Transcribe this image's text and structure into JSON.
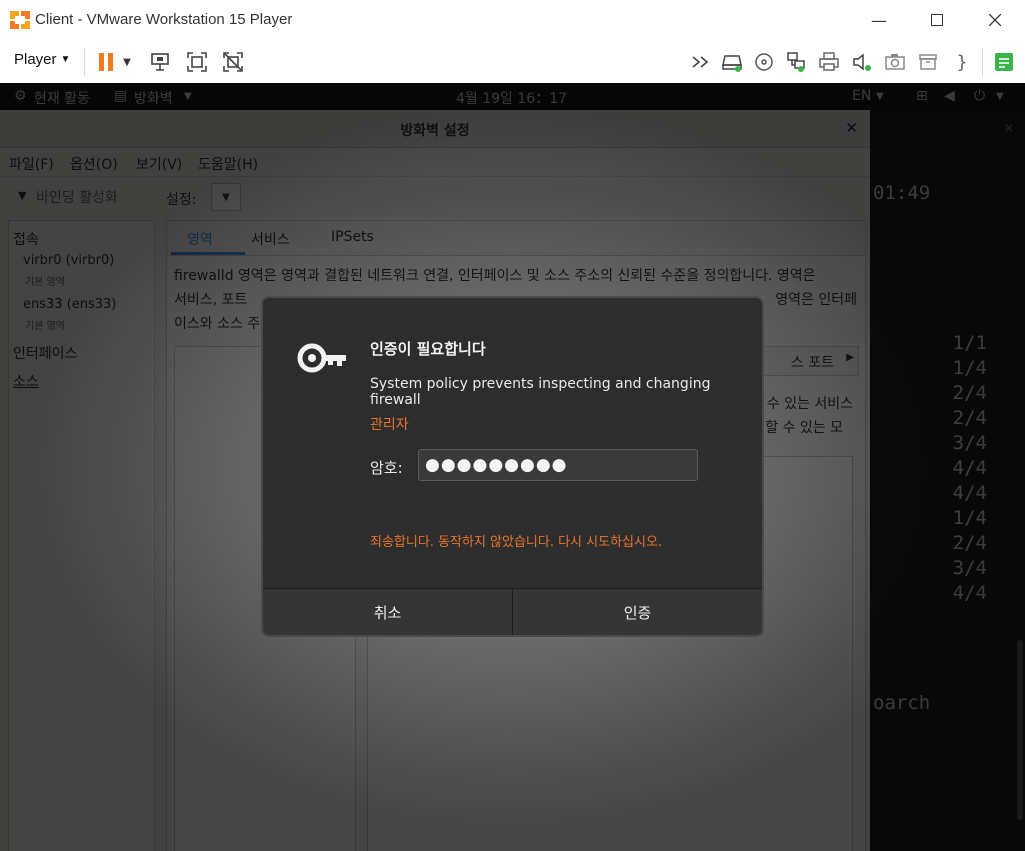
{
  "host": {
    "title": "Client - VMware Workstation 15 Player",
    "player_menu": "Player",
    "window_controls": [
      "minimize-icon",
      "maximize-icon",
      "close-icon"
    ],
    "toolbar_icons": [
      "pause-icon",
      "send-ctrl-alt-del-icon",
      "fit-guest-icon",
      "unity-icon",
      "forward-icon",
      "hard-disk-icon",
      "cd-icon",
      "network-icon",
      "printer-icon",
      "sound-icon",
      "camera-icon",
      "archive-icon",
      "brace-icon",
      "notes-icon"
    ],
    "accent_color": "#f07b22"
  },
  "guest_topbar": {
    "activities": "현재 활동",
    "app_menu": "방화벽",
    "clock": "4월 19일  16：17",
    "lang": "EN"
  },
  "terminal": {
    "time": "01:49",
    "counts": [
      "1/1",
      "1/4",
      "2/4",
      "2/4",
      "3/4",
      "4/4",
      "4/4",
      "1/4",
      "2/4",
      "3/4",
      "4/4"
    ],
    "footer_text": "oarch"
  },
  "firewall": {
    "title": "방화벽 설정",
    "menu": [
      "파일(F)",
      "옵션(O)",
      "보기(V)",
      "도움말(H)"
    ],
    "active_bindings": "바인딩 활성화",
    "config_label": "설정:",
    "sidebar": {
      "section_connections": "접속",
      "connections": [
        {
          "name": "virbr0 (virbr0)",
          "zone": "기본 영역"
        },
        {
          "name": "ens33 (ens33)",
          "zone": "기본 영역"
        }
      ],
      "interfaces": "인터페이스",
      "sources": "소스"
    },
    "tabs": [
      "영역",
      "서비스",
      "IPSets"
    ],
    "description_line1": "firewalld 영역은 영역과 결합된 네트워크 연결, 인터페이스 및 소스 주소의 신뢰된 수준을 정의합니다. 영역은",
    "description_line2": "서비스, 포트 ",
    "description_line2_end": " 영역은 인터페",
    "description_line3": "이스와 소스 주",
    "sub_tab_end": "스 포트",
    "sub_line1": "수 있는 서비스",
    "sub_line2": "할 수 있는 모"
  },
  "auth_dialog": {
    "heading": "인증이 필요합니다",
    "message": "System policy prevents inspecting and changing firewall",
    "user": "관리자",
    "password_label": "암호:",
    "password_value": "●●●●●●●●●",
    "error": "죄송합니다. 동작하지 않았습니다. 다시 시도하십시오.",
    "cancel": "취소",
    "authenticate": "인증",
    "error_color": "#e8752b"
  }
}
